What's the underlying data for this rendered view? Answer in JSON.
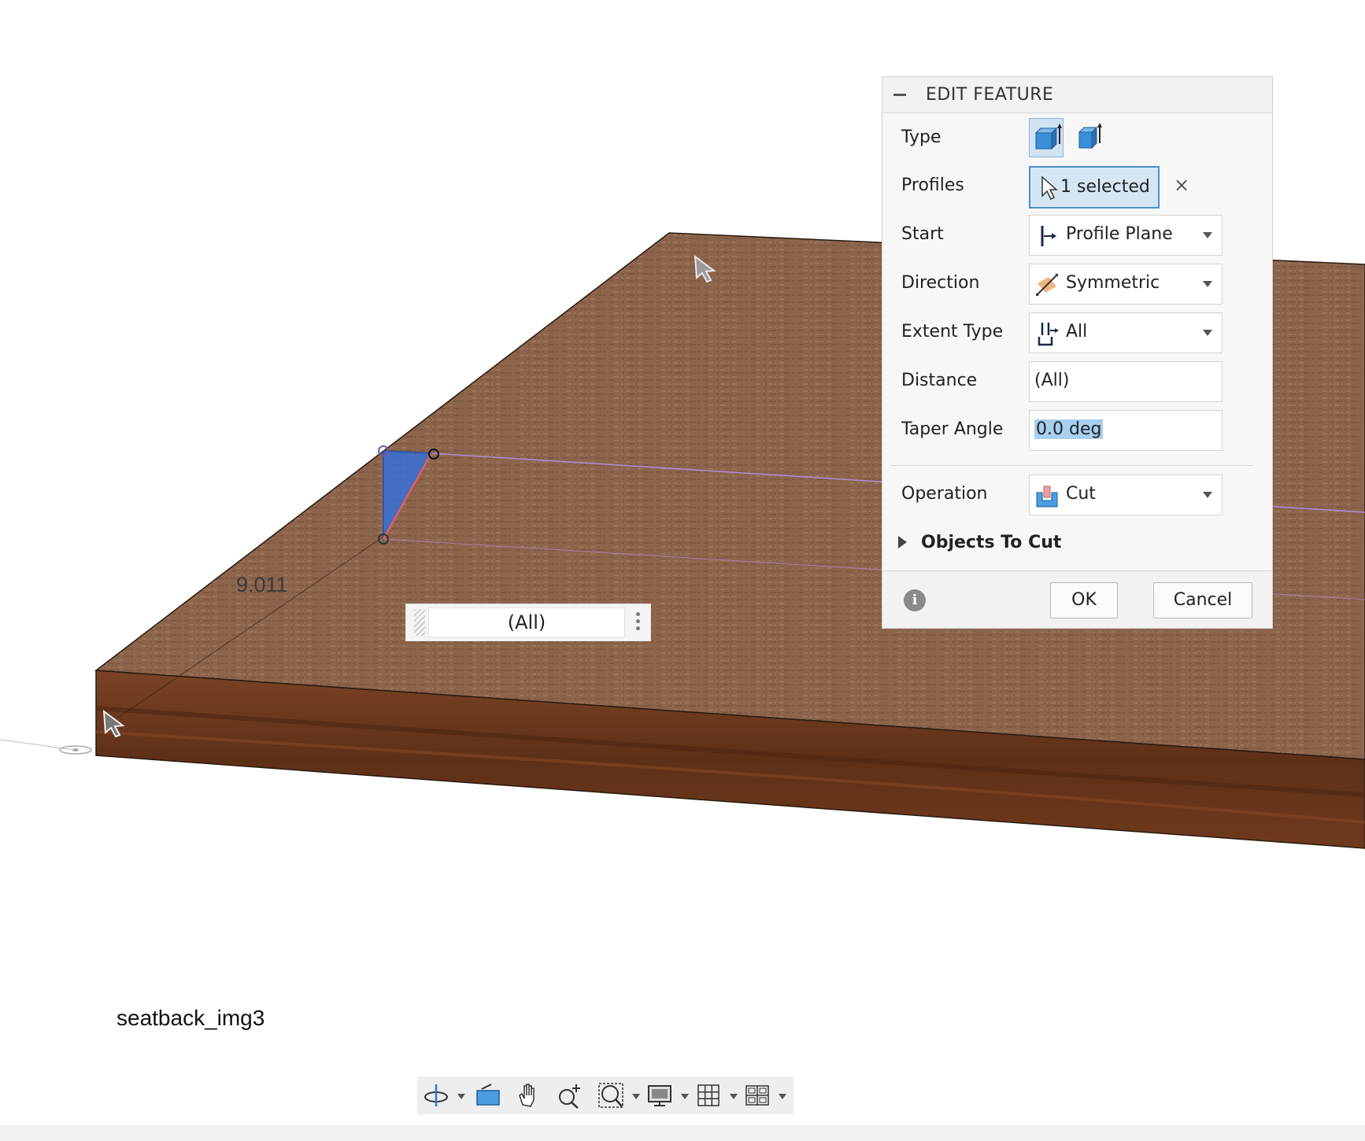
{
  "viewport": {
    "dimension_value": "9.011",
    "caption": "seatback_img3",
    "floating_input_value": "(All)"
  },
  "panel": {
    "title": "EDIT FEATURE",
    "type_label": "Type",
    "profiles_label": "Profiles",
    "profiles_value": "1 selected",
    "start_label": "Start",
    "start_value": "Profile Plane",
    "direction_label": "Direction",
    "direction_value": "Symmetric",
    "extent_label": "Extent Type",
    "extent_value": "All",
    "distance_label": "Distance",
    "distance_value": "(All)",
    "taper_label": "Taper Angle",
    "taper_value": "0.0 deg",
    "operation_label": "Operation",
    "operation_value": "Cut",
    "objects_section": "Objects To Cut",
    "ok_label": "OK",
    "cancel_label": "Cancel",
    "info_glyph": "i",
    "clear_glyph": "×"
  },
  "colors": {
    "wood_top": "#8a6249",
    "wood_side": "#6d3a1e",
    "profile_fill": "#3c6fd0",
    "accent_blue": "#4d8fcb",
    "selection_highlight": "#a7cff0"
  },
  "icons": {
    "toolbar": [
      "orbit-icon",
      "look-at-icon",
      "pan-icon",
      "zoom-icon",
      "fit-icon",
      "display-settings-icon",
      "grid-icon",
      "viewports-icon"
    ]
  }
}
